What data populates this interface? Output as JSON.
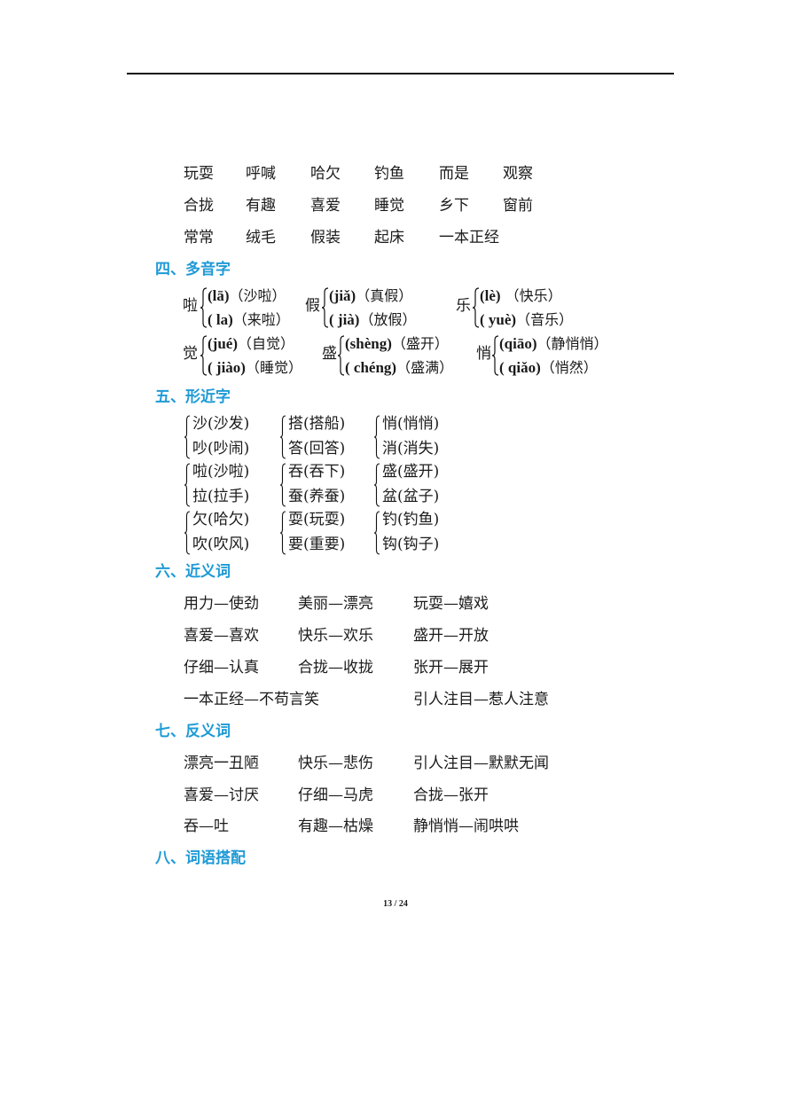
{
  "vocab_rows": [
    [
      "玩耍",
      "呼喊",
      "哈欠",
      "钓鱼",
      "而是",
      "观察"
    ],
    [
      "合拢",
      "有趣",
      "喜爱",
      "睡觉",
      "乡下",
      "窗前"
    ],
    [
      "常常",
      "绒毛",
      "假装",
      "起床",
      "一本正经"
    ]
  ],
  "sections": {
    "polyphones": {
      "title": "四、多音字",
      "groups": [
        {
          "char": "啦",
          "readings": [
            {
              "pinyin": "(lā)",
              "word": "（沙啦）"
            },
            {
              "pinyin": "( la)",
              "word": "（来啦）"
            }
          ]
        },
        {
          "char": "假",
          "readings": [
            {
              "pinyin": "(jiǎ)",
              "word": "（真假）"
            },
            {
              "pinyin": "( jià)",
              "word": "（放假）"
            }
          ]
        },
        {
          "char": "乐",
          "readings": [
            {
              "pinyin": "(lè)",
              "word": " （快乐）"
            },
            {
              "pinyin": "( yuè)",
              "word": "（音乐）"
            }
          ]
        },
        {
          "char": "觉",
          "readings": [
            {
              "pinyin": "(jué)",
              "word": "（自觉）"
            },
            {
              "pinyin": "( jiào)",
              "word": "（睡觉）"
            }
          ]
        },
        {
          "char": "盛",
          "readings": [
            {
              "pinyin": "(shèng)",
              "word": "（盛开）"
            },
            {
              "pinyin": "( chéng)",
              "word": "（盛满）"
            }
          ]
        },
        {
          "char": "悄",
          "readings": [
            {
              "pinyin": "(qiāo)",
              "word": "（静悄悄）"
            },
            {
              "pinyin": "( qiǎo)",
              "word": "（悄然）"
            }
          ]
        }
      ]
    },
    "similar_chars": {
      "title": "五、形近字",
      "groups": [
        [
          "沙(沙发)",
          "吵(吵闹)"
        ],
        [
          "搭(搭船)",
          "答(回答)"
        ],
        [
          "悄(悄悄)",
          "消(消失)"
        ],
        [
          "啦(沙啦)",
          "拉(拉手)"
        ],
        [
          "吞(吞下)",
          "蚕(养蚕)"
        ],
        [
          "盛(盛开)",
          "盆(盆子)"
        ],
        [
          "欠(哈欠)",
          "吹(吹风)"
        ],
        [
          "耍(玩耍)",
          "要(重要)"
        ],
        [
          "钓(钓鱼)",
          "钩(钩子)"
        ]
      ]
    },
    "synonyms": {
      "title": "六、近义词",
      "rows": [
        [
          "用力—使劲",
          "美丽—漂亮",
          "玩耍—嬉戏"
        ],
        [
          "喜爱—喜欢",
          "快乐—欢乐",
          "盛开—开放"
        ],
        [
          "仔细—认真",
          "合拢—收拢",
          "张开—展开"
        ],
        [
          "一本正经—不苟言笑",
          "",
          "引人注目—惹人注意"
        ]
      ]
    },
    "antonyms": {
      "title": "七、反义词",
      "rows": [
        [
          "漂亮一丑陋",
          "快乐—悲伤",
          "引人注目—默默无闻"
        ],
        [
          "喜爱—讨厌",
          "仔细—马虎",
          "合拢—张开"
        ],
        [
          "吞—吐",
          "有趣—枯燥",
          "静悄悄—闹哄哄"
        ]
      ]
    },
    "collocation": {
      "title": "八、词语搭配"
    }
  },
  "footer": {
    "page_indicator": "13 / 24"
  }
}
